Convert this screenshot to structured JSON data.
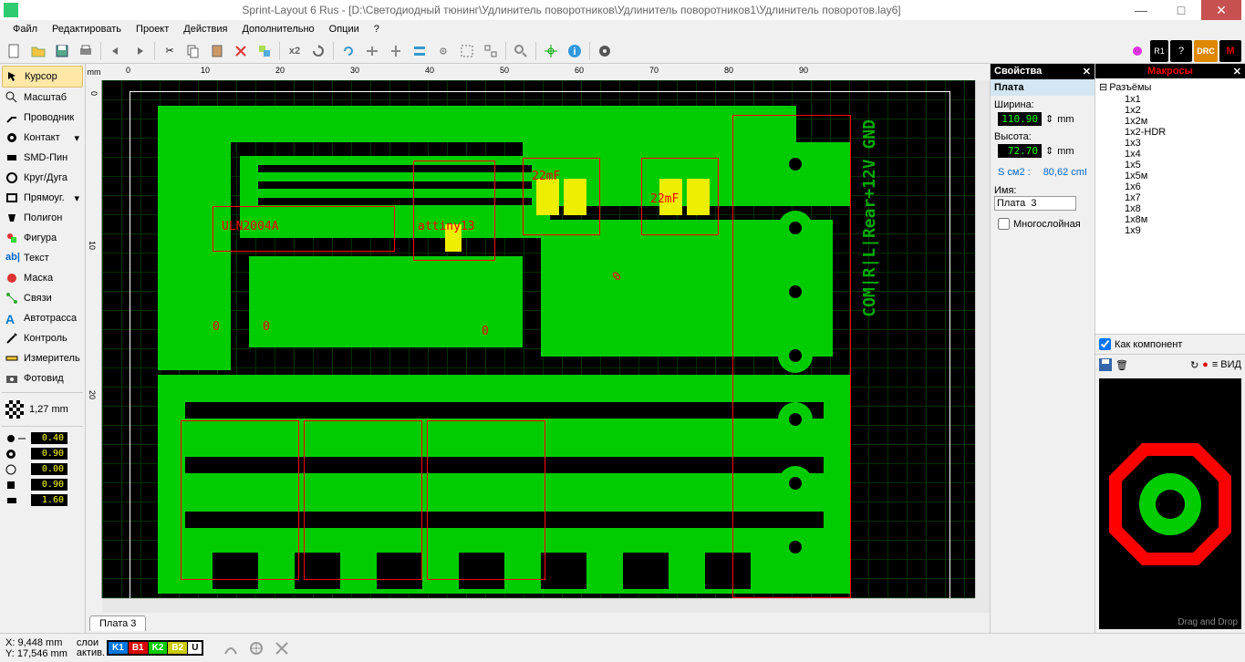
{
  "title": "Sprint-Layout 6 Rus - [D:\\Светодиодный тюнинг\\Удлинитель поворотников\\Удлинитель поворотников1\\Удлинитель поворотов.lay6]",
  "menu": [
    "Файл",
    "Редактировать",
    "Проект",
    "Действия",
    "Дополнительно",
    "Опции",
    "?"
  ],
  "tools": {
    "cursor": "Курсор",
    "zoom": "Масштаб",
    "track": "Проводник",
    "pad": "Контакт",
    "smd": "SMD-Пин",
    "circle": "Круг/Дуга",
    "rect": "Прямоуг.",
    "polygon": "Полигон",
    "figure": "Фигура",
    "text": "Текст",
    "mask": "Маска",
    "net": "Связи",
    "autoroute": "Автотрасса",
    "inspect": "Контроль",
    "measure": "Измеритель",
    "photo": "Фотовид"
  },
  "grid_value": "1,27 mm",
  "dims": {
    "d1": "0.40",
    "d2": "0.90",
    "d3": "0.00",
    "d4": "0.90",
    "d5": "1.60"
  },
  "ruler_unit": "mm",
  "ruler_ticks": [
    "0",
    "10",
    "20",
    "30",
    "40",
    "50",
    "60",
    "70",
    "80",
    "90"
  ],
  "ruler_v": [
    "0",
    "10",
    "20"
  ],
  "pcb_labels": {
    "uln": "ULN2004A",
    "attiny": "attiny13",
    "cap1": "22mF",
    "cap2": "22mF",
    "r1": "0",
    "r2": "0",
    "r3": "0",
    "r4": "0",
    "silk": "COM|R|L|Rear+12V GND"
  },
  "tab_name": "Плата  3",
  "props": {
    "panel": "Свойства",
    "section": "Плата",
    "width_lbl": "Ширина:",
    "width_val": "110.90",
    "height_lbl": "Высота:",
    "height_val": "72.70",
    "unit": "mm",
    "area_lbl": "S см2 :",
    "area_val": "80,62 cmІ",
    "name_lbl": "Имя:",
    "name_val": "Плата  3",
    "multilayer": "Многослойная"
  },
  "macros": {
    "title": "Макросы",
    "root": "Разъёмы",
    "items": [
      "1x1",
      "1x2",
      "1x2м",
      "1x2-HDR",
      "1x3",
      "1x4",
      "1x5",
      "1x5м",
      "1x6",
      "1x7",
      "1x8",
      "1x8м",
      "1x9"
    ],
    "as_component": "Как компонент",
    "vid": "ВИД",
    "drop": "Drag and Drop"
  },
  "status": {
    "x": "X:     9,448 mm",
    "y": "Y:   17,546 mm",
    "layers_lbl": "слои",
    "active": "актив.",
    "layers": [
      {
        "name": "K1",
        "color": "#0077dd"
      },
      {
        "name": "B1",
        "color": "#dd0000"
      },
      {
        "name": "K2",
        "color": "#00cc00"
      },
      {
        "name": "B2",
        "color": "#dddd00"
      },
      {
        "name": "U",
        "color": "#ffffff"
      }
    ]
  },
  "toolbar_labels": {
    "x2": "x2",
    "drc": "DRC"
  }
}
